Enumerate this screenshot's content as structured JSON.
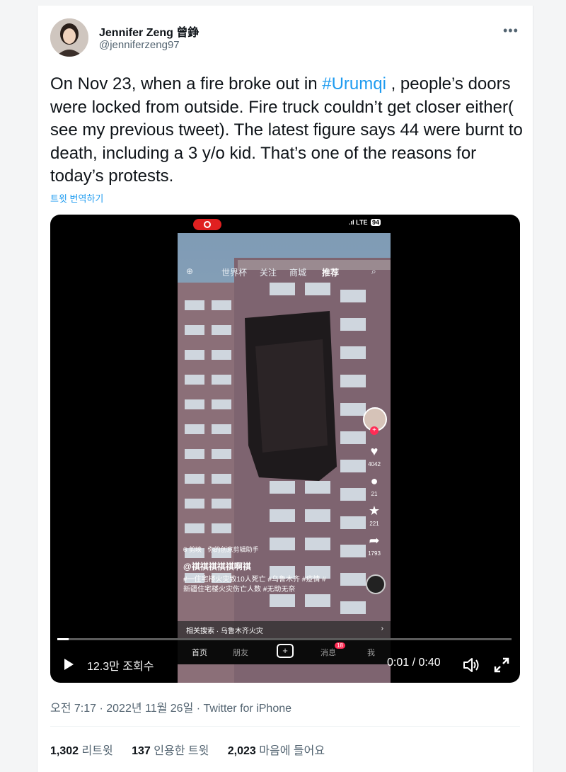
{
  "author": {
    "display_name": "Jennifer Zeng 曾錚",
    "handle": "@jenniferzeng97"
  },
  "tweet": {
    "text_before": "On Nov 23, when a fire broke out in ",
    "hashtag": "#Urumqi",
    "text_after": " , people’s doors were locked from outside. Fire truck couldn’t get closer either( see my previous tweet). The latest figure says 44 were burnt to death, including a 3 y/o kid. That’s one of the reasons for today’s protests.",
    "translate_link": "트윗 번역하기"
  },
  "video": {
    "views": "12.3만 조회수",
    "timecode": "0:01 / 0:40",
    "progress_fraction": 0.025,
    "phone": {
      "status_lte": "LTE",
      "status_battery": "94",
      "tabs": [
        "世界杯",
        "关注",
        "商城",
        "推荐"
      ],
      "likes": "4042",
      "comments": "21",
      "favorites": "221",
      "shares": "1793",
      "app_tag": "剪映",
      "app_tag_sub": "你的创意剪辑助手",
      "username": "@祺祺祺祺祺啊祺",
      "caption": "#一住宅楼火灾致10人死亡 #乌鲁木齐 #疫情 #新疆住宅楼火灾伤亡人数 #无助无奈",
      "related_search": "相关搜索 · 乌鲁木齐火灾",
      "nav": [
        "首页",
        "朋友",
        "消息",
        "我"
      ],
      "nav_badge": "18"
    }
  },
  "meta": {
    "timestamp": "오전 7:17 · 2022년 11월 26일 · Twitter for iPhone"
  },
  "stats": {
    "retweets_count": "1,302",
    "retweets_label": "리트윗",
    "quotes_count": "137",
    "quotes_label": "인용한 트윗",
    "likes_count": "2,023",
    "likes_label": "마음에 들어요"
  },
  "colors": {
    "link": "#1d9bf0",
    "secondary_text": "#536471",
    "primary_text": "#0f1419"
  }
}
